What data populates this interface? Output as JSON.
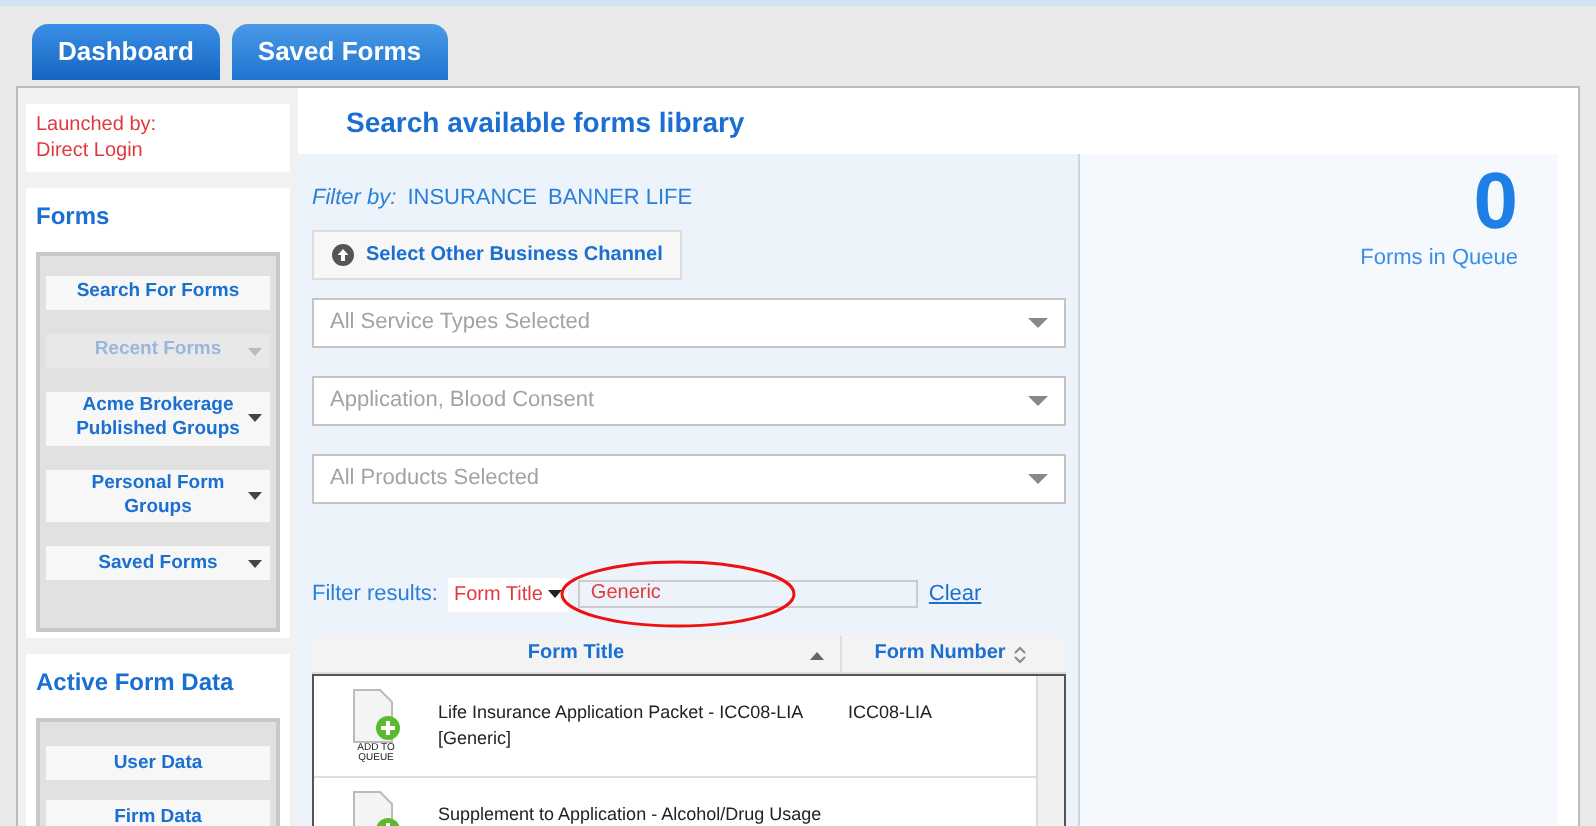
{
  "tabs": [
    {
      "label": "Dashboard",
      "selected": true
    },
    {
      "label": "Saved Forms",
      "selected": false
    }
  ],
  "launch": {
    "label": "Launched by:",
    "value": "Direct Login"
  },
  "forms_panel": {
    "title": "Forms",
    "items": [
      {
        "label": "Search For Forms",
        "kind": "plain",
        "disabled": false
      },
      {
        "label": "Recent Forms",
        "kind": "dropdown",
        "disabled": true
      },
      {
        "label": "Acme Brokerage Published Groups",
        "kind": "dropdown",
        "disabled": false
      },
      {
        "label": "Personal Form Groups",
        "kind": "dropdown",
        "disabled": false
      },
      {
        "label": "Saved Forms",
        "kind": "dropdown",
        "disabled": false
      }
    ]
  },
  "active_panel": {
    "title": "Active Form Data",
    "items": [
      {
        "label": "User Data"
      },
      {
        "label": "Firm Data"
      }
    ]
  },
  "page_title": "Search available forms library",
  "filter_by": {
    "label": "Filter by:",
    "values": [
      "INSURANCE",
      "BANNER LIFE"
    ]
  },
  "channel_button": "Select Other Business Channel",
  "selects": [
    "All Service Types Selected",
    "Application, Blood Consent",
    "All Products Selected"
  ],
  "filter_results": {
    "label": "Filter results:",
    "field": "Form Title",
    "value": "Generic",
    "clear": "Clear",
    "highlighted": true
  },
  "table": {
    "columns": [
      "Form Title",
      "Form Number"
    ],
    "rows": [
      {
        "title": "Life Insurance Application Packet - ICC08-LIA [Generic]",
        "number": "ICC08-LIA",
        "icon_label": "ADD TO QUEUE"
      },
      {
        "title": "Supplement to Application - Alcohol/Drug Usage"
      }
    ]
  },
  "queue": {
    "count": "0",
    "label": "Forms in Queue"
  }
}
